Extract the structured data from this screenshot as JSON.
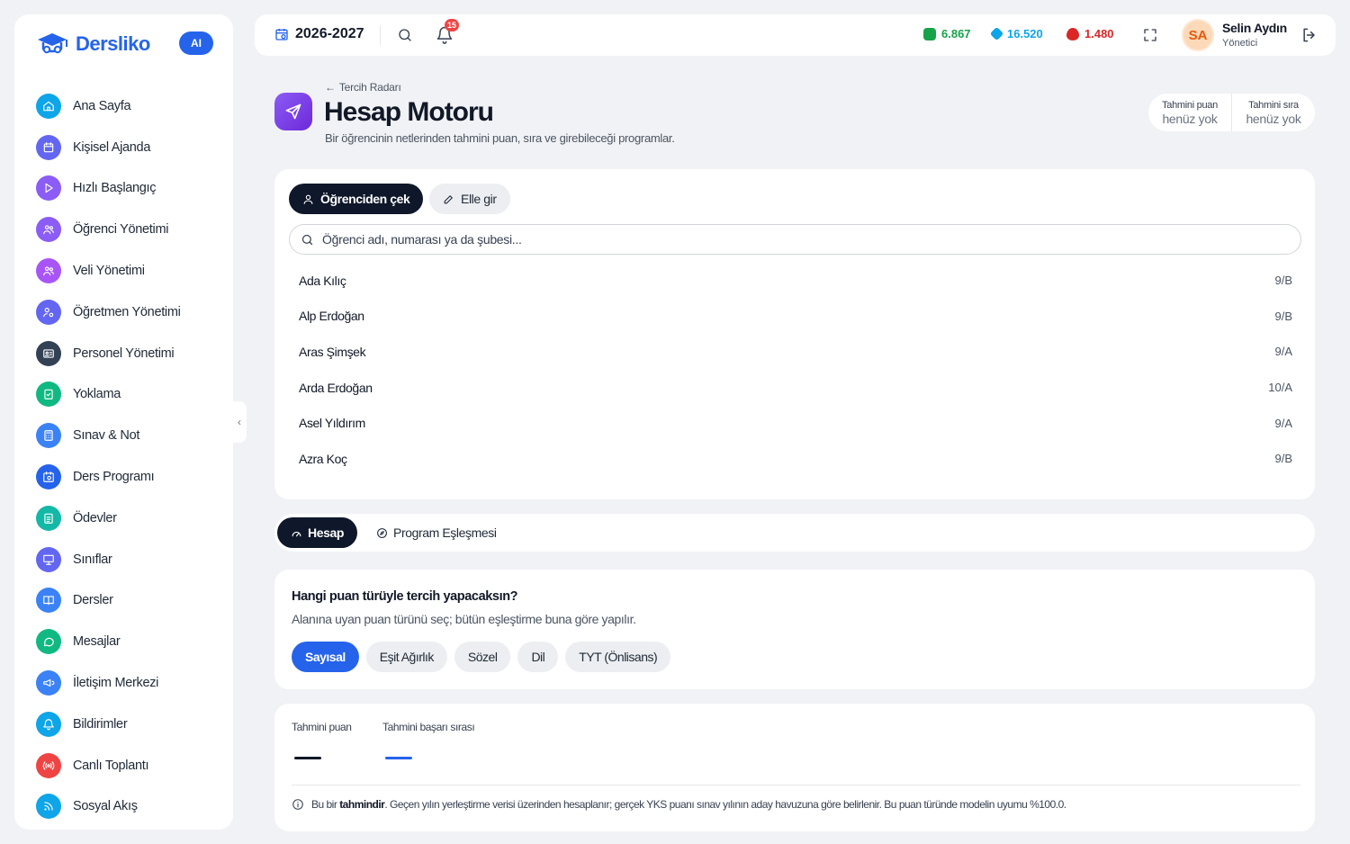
{
  "brand": {
    "name": "Dersliko",
    "ai_badge": "AI"
  },
  "sidebar": {
    "items": [
      {
        "label": "Ana Sayfa",
        "icon": "home-icon",
        "color": "#0ea5e9"
      },
      {
        "label": "Kişisel Ajanda",
        "icon": "calendar-icon",
        "color": "#6366f1"
      },
      {
        "label": "Hızlı Başlangıç",
        "icon": "play-icon",
        "color": "#8b5cf6"
      },
      {
        "label": "Öğrenci Yönetimi",
        "icon": "users-icon",
        "color": "#8b5cf6"
      },
      {
        "label": "Veli Yönetimi",
        "icon": "users-icon",
        "color": "#a855f7"
      },
      {
        "label": "Öğretmen Yönetimi",
        "icon": "user-gear-icon",
        "color": "#6366f1"
      },
      {
        "label": "Personel Yönetimi",
        "icon": "id-card-icon",
        "color": "#334155"
      },
      {
        "label": "Yoklama",
        "icon": "clipboard-check-icon",
        "color": "#10b981"
      },
      {
        "label": "Sınav & Not",
        "icon": "calculator-icon",
        "color": "#3b82f6"
      },
      {
        "label": "Ders Programı",
        "icon": "calendar-clock-icon",
        "color": "#2563eb"
      },
      {
        "label": "Ödevler",
        "icon": "clipboard-list-icon",
        "color": "#14b8a6"
      },
      {
        "label": "Sınıflar",
        "icon": "presentation-icon",
        "color": "#6366f1"
      },
      {
        "label": "Dersler",
        "icon": "book-open-icon",
        "color": "#3b82f6"
      },
      {
        "label": "Mesajlar",
        "icon": "message-circle-icon",
        "color": "#10b981"
      },
      {
        "label": "İletişim Merkezi",
        "icon": "megaphone-icon",
        "color": "#3b82f6"
      },
      {
        "label": "Bildirimler",
        "icon": "bell-icon",
        "color": "#0ea5e9"
      },
      {
        "label": "Canlı Toplantı",
        "icon": "radio-icon",
        "color": "#ef4444"
      },
      {
        "label": "Sosyal Akış",
        "icon": "rss-icon",
        "color": "#0ea5e9"
      }
    ]
  },
  "topbar": {
    "year": "2026-2027",
    "notification_count": "15",
    "stats": [
      {
        "value": "6.867",
        "color": "#16a34a",
        "icon": "green-gem-icon"
      },
      {
        "value": "16.520",
        "color": "#0ea5e9",
        "icon": "blue-gem-icon"
      },
      {
        "value": "1.480",
        "color": "#dc2626",
        "icon": "fire-icon"
      }
    ],
    "user": {
      "initials": "SA",
      "name": "Selin Aydın",
      "role": "Yönetici"
    }
  },
  "header": {
    "back_label": "Tercih Radarı",
    "title": "Hesap Motoru",
    "subtitle": "Bir öğrencinin netlerinden tahmini puan, sıra ve girebileceği programlar.",
    "estimate": {
      "score_label": "Tahmini puan",
      "score_value": "henüz yok",
      "rank_label": "Tahmini sıra",
      "rank_value": "henüz yok"
    }
  },
  "student_picker": {
    "from_student_label": "Öğrenciden çek",
    "manual_label": "Elle gir",
    "search_placeholder": "Öğrenci adı, numarası ya da şubesi...",
    "students": [
      {
        "name": "Ada Kılıç",
        "class": "9/B"
      },
      {
        "name": "Alp Erdoğan",
        "class": "9/B"
      },
      {
        "name": "Aras Şimşek",
        "class": "9/A"
      },
      {
        "name": "Arda Erdoğan",
        "class": "10/A"
      },
      {
        "name": "Asel Yıldırım",
        "class": "9/A"
      },
      {
        "name": "Azra Koç",
        "class": "9/B"
      }
    ]
  },
  "tabs": {
    "active": "Hesap",
    "inactive": "Program Eşleşmesi"
  },
  "score_type": {
    "question": "Hangi puan türüyle tercih yapacaksın?",
    "hint": "Alanına uyan puan türünü seç; bütün eşleştirme buna göre yapılır.",
    "options": [
      "Sayısal",
      "Eşit Ağırlık",
      "Sözel",
      "Dil",
      "TYT (Önlisans)"
    ],
    "selected": "Sayısal"
  },
  "result": {
    "score_label": "Tahmini puan",
    "rank_label": "Tahmini başarı sırası",
    "score_dash_color": "#111827",
    "rank_dash_color": "#2563eb",
    "info_prefix": "Bu bir ",
    "info_bold": "tahmindir",
    "info_rest": ". Geçen yılın yerleştirme verisi üzerinden hesaplanır; gerçek YKS puanı sınav yılının aday havuzuna göre belirlenir. Bu puan türünde modelin uyumu %100.0."
  }
}
